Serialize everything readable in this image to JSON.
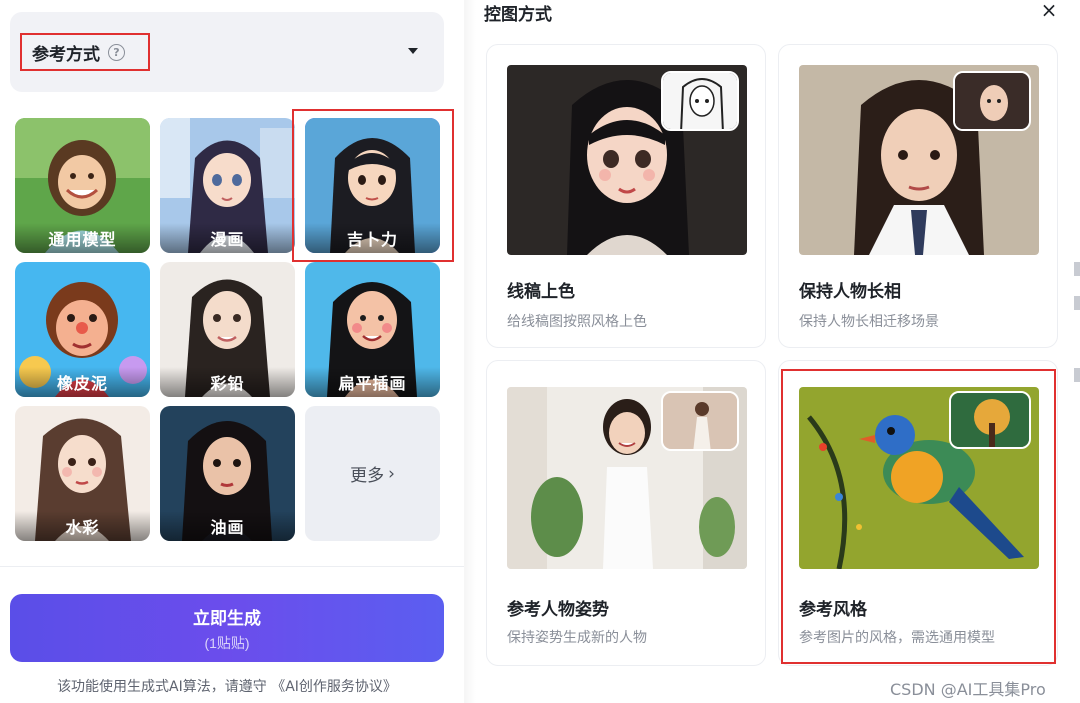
{
  "reference": {
    "title": "参考方式",
    "help_icon": "?"
  },
  "styles": [
    {
      "label": "通用模型",
      "icon": "smiling-girl-photo"
    },
    {
      "label": "漫画",
      "icon": "anime-girl"
    },
    {
      "label": "吉卜力",
      "icon": "ghibli-girl",
      "selected": true
    },
    {
      "label": "橡皮泥",
      "icon": "clay-figure"
    },
    {
      "label": "彩铅",
      "icon": "colored-pencil-woman"
    },
    {
      "label": "扁平插画",
      "icon": "flat-illustration-woman"
    },
    {
      "label": "水彩",
      "icon": "watercolor-woman"
    },
    {
      "label": "油画",
      "icon": "oil-painting-woman"
    }
  ],
  "more": {
    "label": "更多",
    "chevron": "›"
  },
  "generate": {
    "label": "立即生成",
    "cost": "(1贴贴)"
  },
  "disclaimer": "该功能使用生成式AI算法，请遵守 《AI创作服务协议》",
  "panel": {
    "title": "控图方式",
    "close": "×",
    "cards": [
      {
        "title": "线稿上色",
        "desc": "给线稿图按照风格上色"
      },
      {
        "title": "保持人物长相",
        "desc": "保持人物长相迁移场景"
      },
      {
        "title": "参考人物姿势",
        "desc": "保持姿势生成新的人物"
      },
      {
        "title": "参考风格",
        "desc": "参考图片的风格，需选通用模型"
      }
    ]
  },
  "watermark": "CSDN @AI工具集Pro",
  "colors": {
    "accent": "#6c5ce7",
    "highlight_red": "#e03030",
    "button_gradient_start": "#5a4ee8",
    "button_gradient_end": "#5b5ef0"
  }
}
